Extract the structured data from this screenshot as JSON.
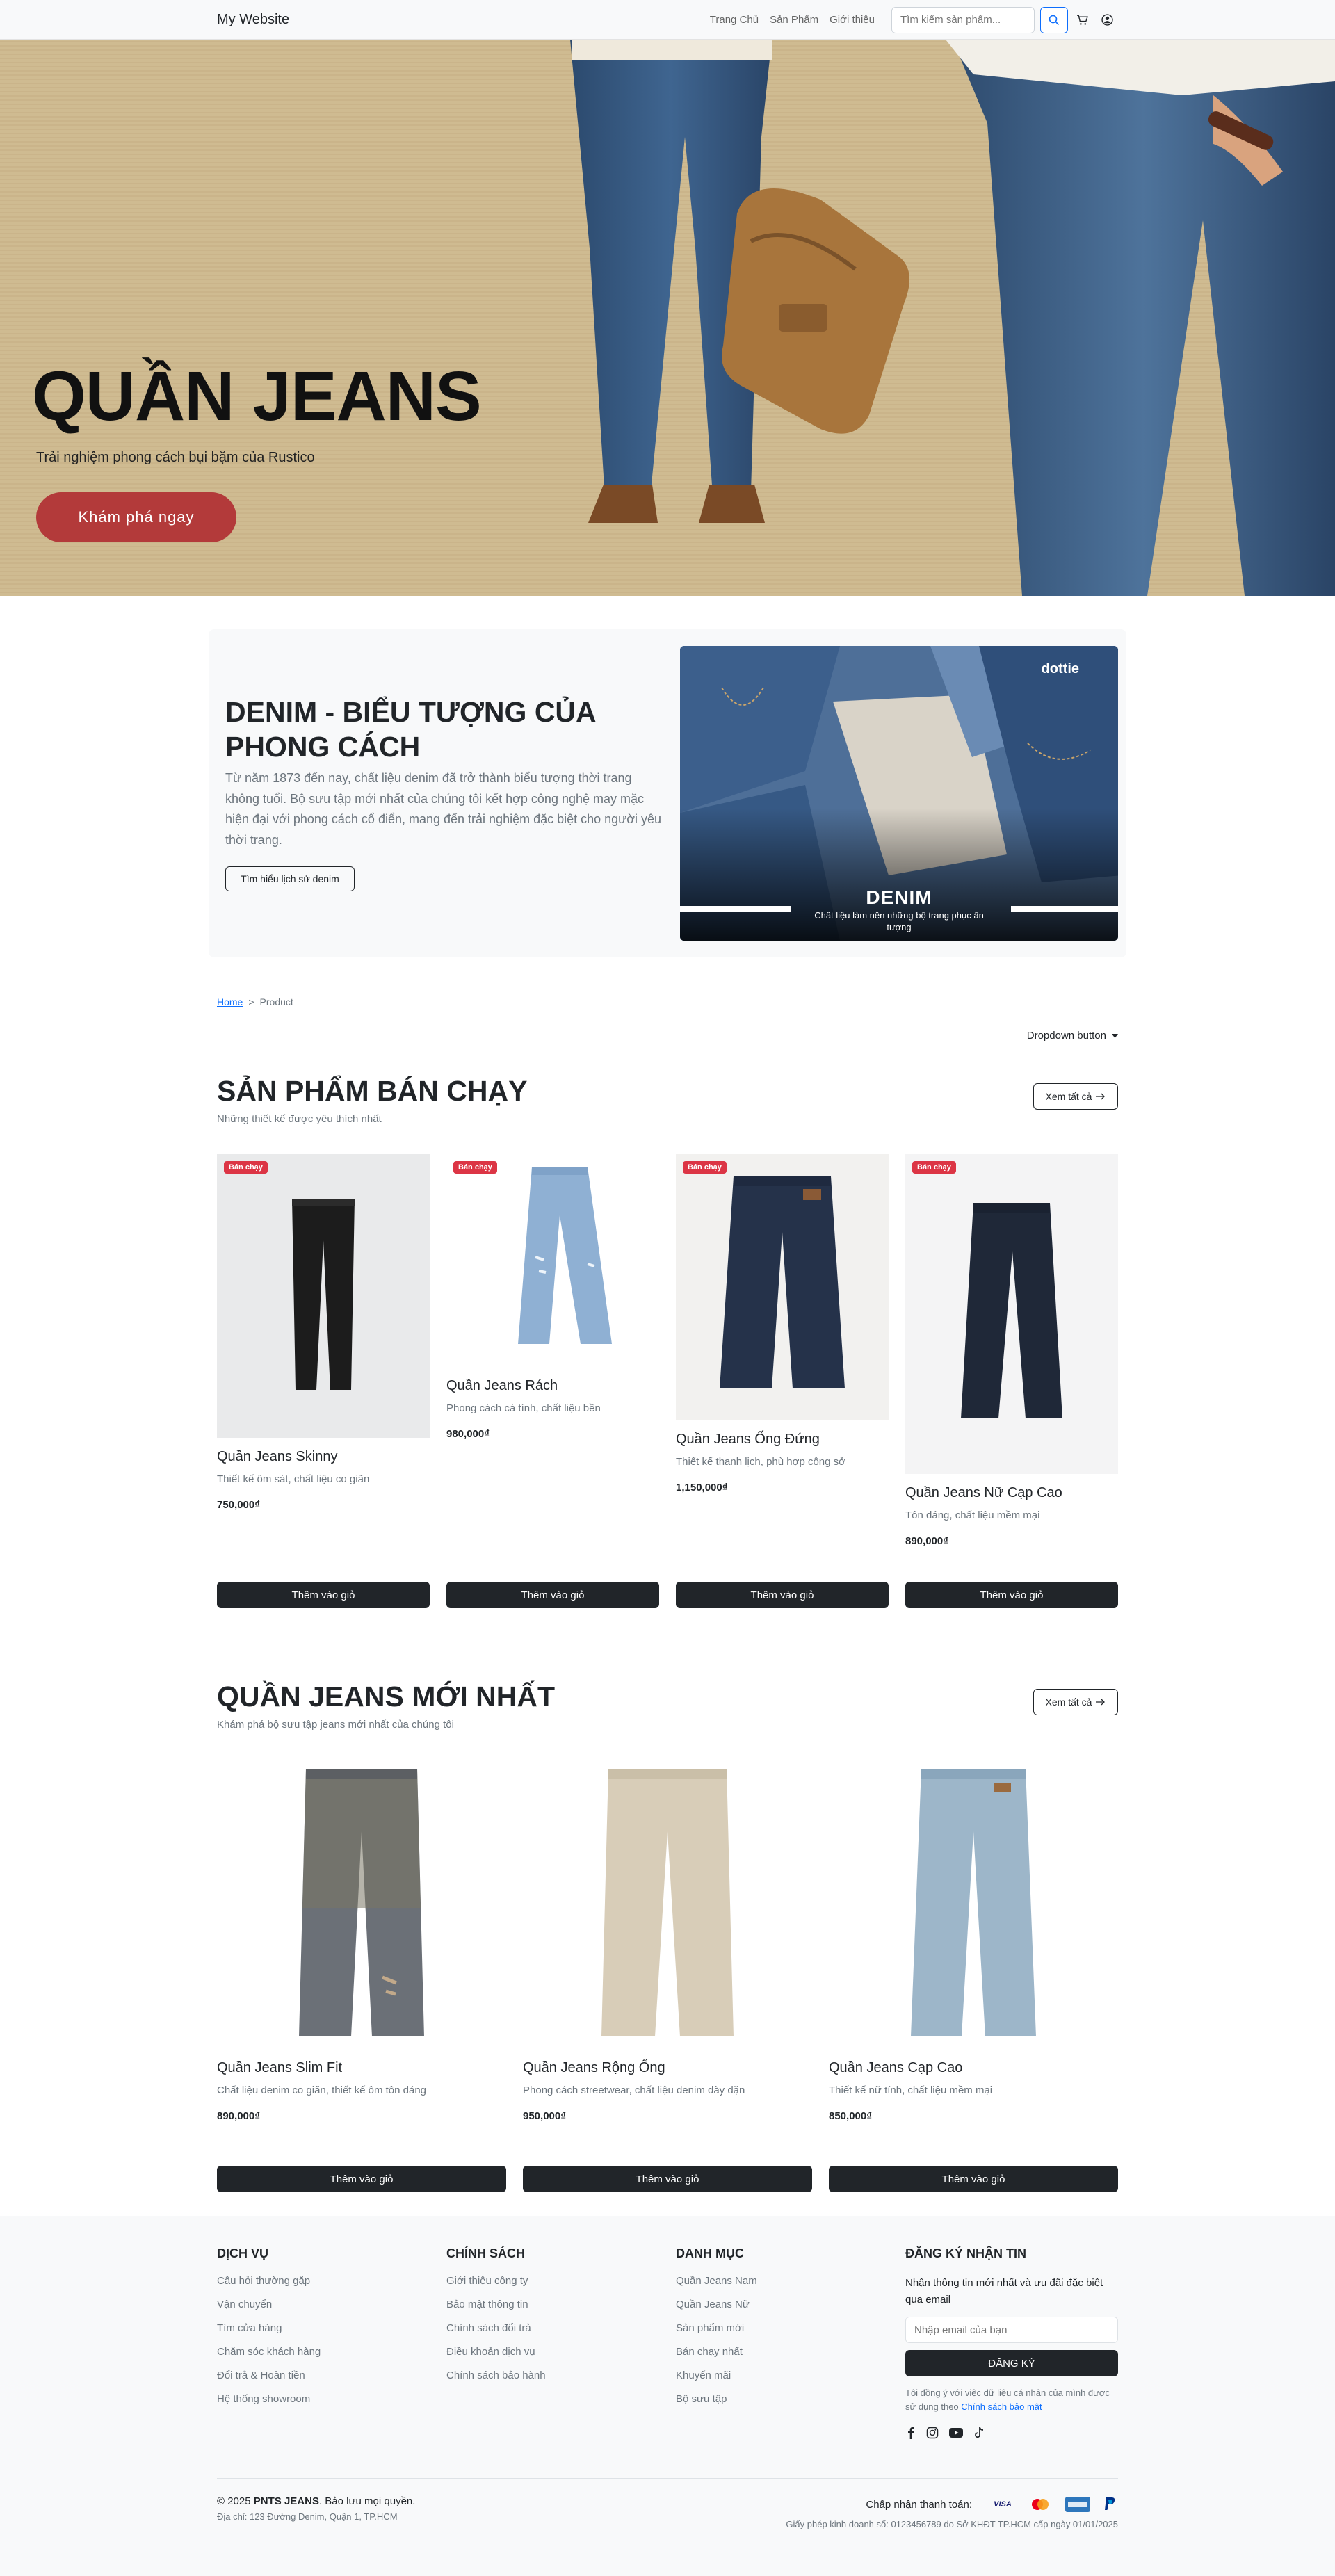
{
  "navbar": {
    "brand": "My Website",
    "links": [
      "Trang Chủ",
      "Sản Phẩm",
      "Giới thiệu"
    ],
    "search_placeholder": "Tìm kiếm sản phẩm...",
    "icons": [
      "search-icon",
      "cart-icon",
      "user-icon"
    ]
  },
  "hero": {
    "title": "QUẦN JEANS",
    "subtitle": "Trải nghiệm phong cách bụi bặm của Rustico",
    "cta": "Khám phá ngay"
  },
  "intro": {
    "title": "DENIM - BIỂU TƯỢNG CỦA PHONG CÁCH",
    "description": "Từ năm 1873 đến nay, chất liệu denim đã trở thành biểu tượng thời trang không tuổi. Bộ sưu tập mới nhất của chúng tôi kết hợp công nghệ may mặc hiện đại với phong cách cổ điển, mang đến trải nghiệm đặc biệt cho người yêu thời trang.",
    "button": "Tìm hiểu lịch sử denim",
    "image_logo": "dottie",
    "image_title": "DENIM",
    "image_caption": "Chất liệu làm nên những bộ trang phục ấn tượng"
  },
  "breadcrumb": {
    "home": "Home",
    "separator": ">",
    "current": "Product"
  },
  "dropdown": {
    "label": "Dropdown button"
  },
  "bestsellers": {
    "title": "SẢN PHẨM BÁN CHẠY",
    "subtitle": "Những thiết kế được yêu thích nhất",
    "view_all": "Xem tất cả",
    "badge": "Bán chạy",
    "add_label": "Thêm vào giỏ",
    "items": [
      {
        "name": "Quần Jeans Skinny",
        "desc": "Thiết kế ôm sát, chất liệu co giãn",
        "price": "750,000₫"
      },
      {
        "name": "Quần Jeans Rách",
        "desc": "Phong cách cá tính, chất liệu bền",
        "price": "980,000₫"
      },
      {
        "name": "Quần Jeans Ống Đứng",
        "desc": "Thiết kế thanh lịch, phù hợp công sở",
        "price": "1,150,000₫"
      },
      {
        "name": "Quần Jeans Nữ Cạp Cao",
        "desc": "Tôn dáng, chất liệu mềm mại",
        "price": "890,000₫"
      }
    ]
  },
  "newest": {
    "title": "QUẦN JEANS MỚI NHẤT",
    "subtitle": "Khám phá bộ sưu tập jeans mới nhất của chúng tôi",
    "view_all": "Xem tất cả",
    "add_label": "Thêm vào giỏ",
    "items": [
      {
        "name": "Quần Jeans Slim Fit",
        "desc": "Chất liệu denim co giãn, thiết kế ôm tôn dáng",
        "price": "890,000₫"
      },
      {
        "name": "Quần Jeans Rộng Ống",
        "desc": "Phong cách streetwear, chất liệu denim dày dặn",
        "price": "950,000₫"
      },
      {
        "name": "Quần Jeans Cạp Cao",
        "desc": "Thiết kế nữ tính, chất liệu mềm mại",
        "price": "850,000₫"
      }
    ]
  },
  "footer": {
    "services": {
      "title": "DỊCH VỤ",
      "items": [
        "Câu hỏi thường gặp",
        "Vận chuyển",
        "Tìm cửa hàng",
        "Chăm sóc khách hàng",
        "Đổi trả & Hoàn tiền",
        "Hệ thống showroom"
      ]
    },
    "policy": {
      "title": "CHÍNH SÁCH",
      "items": [
        "Giới thiệu công ty",
        "Bảo mật thông tin",
        "Chính sách đổi trả",
        "Điều khoản dịch vụ",
        "Chính sách bảo hành"
      ]
    },
    "categories": {
      "title": "DANH MỤC",
      "items": [
        "Quần Jeans Nam",
        "Quần Jeans Nữ",
        "Sản phẩm mới",
        "Bán chạy nhất",
        "Khuyến mãi",
        "Bộ sưu tập"
      ]
    },
    "newsletter": {
      "title": "ĐĂNG KÝ NHẬN TIN",
      "text": "Nhận thông tin mới nhất và ưu đãi đặc biệt qua email",
      "placeholder": "Nhập email của bạn",
      "button": "ĐĂNG KÝ",
      "consent": "Tôi đồng ý với việc dữ liệu cá nhân của mình được sử dụng theo",
      "consent_link": "Chính sách bảo mật"
    },
    "copyright_prefix": "© 2025",
    "copyright_brand": "PNTS JEANS",
    "copyright_suffix": ". Bảo lưu mọi quyền.",
    "address": "Địa chỉ: 123 Đường Denim, Quận 1, TP.HCM",
    "payment_label": "Chấp nhận thanh toán:",
    "payments": [
      "VISA",
      "Mastercard",
      "AMEX",
      "PayPal"
    ],
    "license": "Giấy phép kinh doanh số: 0123456789 do Sở KHĐT TP.HCM cấp ngày 01/01/2025"
  }
}
